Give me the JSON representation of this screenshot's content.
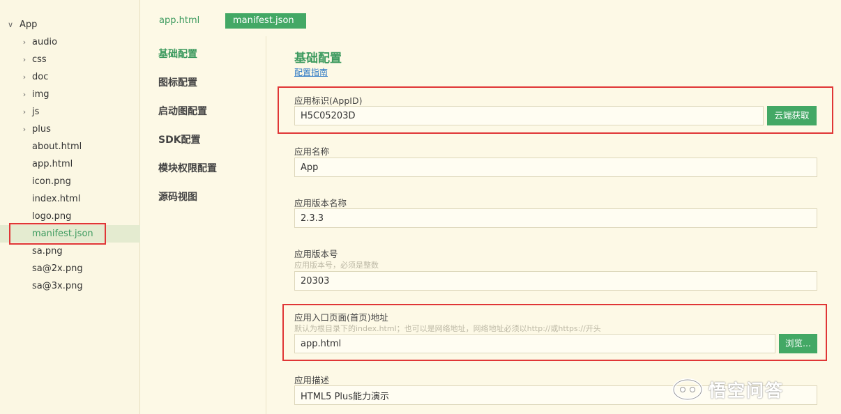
{
  "sidebar": {
    "root_label": "App",
    "items": [
      {
        "label": "audio",
        "folder": true
      },
      {
        "label": "css",
        "folder": true
      },
      {
        "label": "doc",
        "folder": true
      },
      {
        "label": "img",
        "folder": true
      },
      {
        "label": "js",
        "folder": true
      },
      {
        "label": "plus",
        "folder": true
      },
      {
        "label": "about.html",
        "folder": false
      },
      {
        "label": "app.html",
        "folder": false
      },
      {
        "label": "icon.png",
        "folder": false
      },
      {
        "label": "index.html",
        "folder": false
      },
      {
        "label": "logo.png",
        "folder": false
      },
      {
        "label": "manifest.json",
        "folder": false
      },
      {
        "label": "sa.png",
        "folder": false
      },
      {
        "label": "sa@2x.png",
        "folder": false
      },
      {
        "label": "sa@3x.png",
        "folder": false
      }
    ],
    "selected_index": 11
  },
  "tabs": [
    {
      "label": "app.html",
      "active": false
    },
    {
      "label": "manifest.json",
      "active": true
    }
  ],
  "config_nav": [
    {
      "label": "基础配置",
      "active": true
    },
    {
      "label": "图标配置"
    },
    {
      "label": "启动图配置"
    },
    {
      "label": "SDK配置"
    },
    {
      "label": "模块权限配置"
    },
    {
      "label": "源码视图"
    }
  ],
  "main": {
    "title": "基础配置",
    "guide_link": "配置指南",
    "fields": {
      "appid": {
        "label": "应用标识(AppID)",
        "value": "H5C05203D",
        "button": "云端获取"
      },
      "name": {
        "label": "应用名称",
        "value": "App"
      },
      "version_name": {
        "label": "应用版本名称",
        "value": "2.3.3"
      },
      "version_code": {
        "label": "应用版本号",
        "hint": "应用版本号，必须是整数",
        "value": "20303"
      },
      "entry": {
        "label": "应用入口页面(首页)地址",
        "hint": "默认为根目录下的index.html；也可以是网络地址，网络地址必须以http://或https://开头",
        "value": "app.html",
        "button": "浏览..."
      },
      "description": {
        "label": "应用描述",
        "value": "HTML5 Plus能力演示"
      }
    }
  },
  "watermark": {
    "text": "悟空问答",
    "icon": "wukong-logo-icon"
  },
  "colors": {
    "accent": "#43a865",
    "accent_text": "#3c9a5e",
    "highlight": "#e03636",
    "link": "#2b78c5",
    "background": "#fdf9e6"
  }
}
